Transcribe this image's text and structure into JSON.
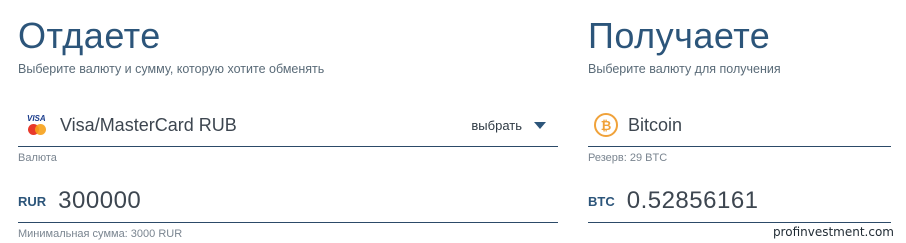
{
  "give": {
    "title": "Отдаете",
    "subtitle": "Выберите валюту и сумму, которую хотите обменять",
    "currency_icon": "visa-mastercard-icon",
    "currency_icon_text": "VISA",
    "currency_name": "Visa/MasterCard RUB",
    "select_label": "выбрать",
    "currency_hint": "Валюта",
    "amount_code": "RUR",
    "amount_value": "300000",
    "amount_hint": "Минимальная сумма: 3000 RUR"
  },
  "receive": {
    "title": "Получаете",
    "subtitle": "Выберите валюту для получения",
    "currency_icon": "bitcoin-icon",
    "currency_icon_text": "₿",
    "currency_name": "Bitcoin",
    "currency_hint": "Резерв: 29 BTC",
    "amount_code": "BTC",
    "amount_value": "0.52856161"
  },
  "watermark": "profinvestment.com",
  "colors": {
    "heading": "#2c557a",
    "underline": "#2c4a68",
    "bitcoin": "#f0a23a",
    "mastercard_red": "#e8392b",
    "mastercard_orange": "#f6a11a"
  }
}
